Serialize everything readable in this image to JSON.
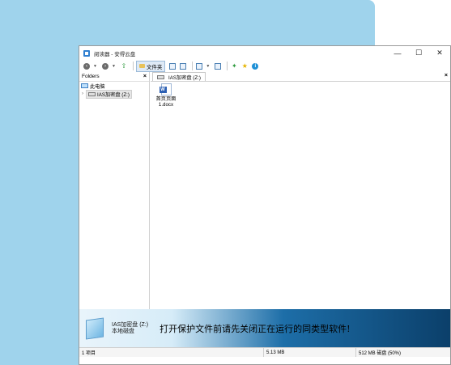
{
  "window": {
    "title": "阅读器 - 安得云盘",
    "controls": {
      "minimize": "—",
      "maximize": "☐",
      "close": "✕"
    }
  },
  "toolbar": {
    "folder_button_label": "文件夹"
  },
  "folders_pane": {
    "header": "Folders",
    "close": "×",
    "tree": [
      {
        "label": "此电脑",
        "icon": "computer-icon"
      },
      {
        "label": "IAS加密盘 (Z:)",
        "icon": "drive-icon",
        "expander": "›"
      }
    ]
  },
  "content_pane": {
    "tab_label": "IAS加密盘 (Z:)",
    "close": "×",
    "files": [
      {
        "name_line1": "首页页面",
        "name_line2": "1.docx",
        "icon": "word-document-icon",
        "badge": "W"
      }
    ]
  },
  "banner": {
    "drive_name": "IAS加密盘 (Z:)",
    "drive_type": "本地磁盘",
    "message": "打开保护文件前请先关闭正在运行的同类型软件!"
  },
  "status_bar": {
    "items_count": "1 项目",
    "size": "5.13 MB",
    "capacity": "512 MB 磁盘 (50%)"
  },
  "colors": {
    "desktop_background": "#9fd3ec",
    "banner_dark": "#0b3f6a",
    "accent_blue": "#1e90d6"
  }
}
